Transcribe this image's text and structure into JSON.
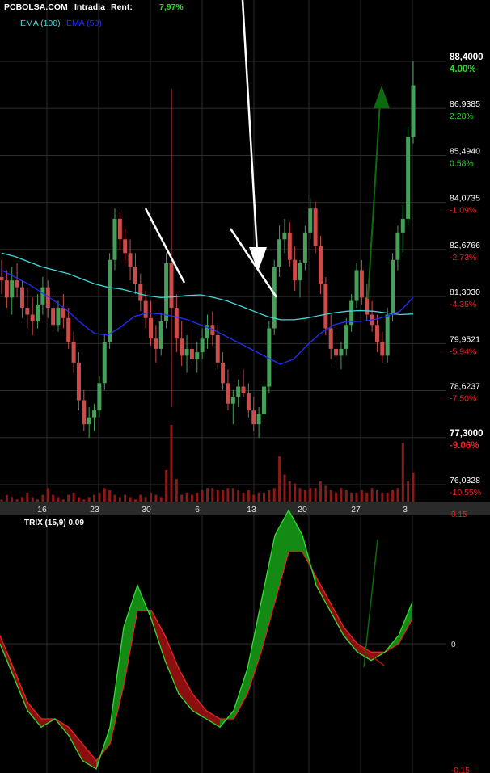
{
  "header": {
    "site": "PCBOLSA.COM",
    "mode": "Intradia",
    "rent_label": "Rent:",
    "rent_value": "7,97%"
  },
  "legend": {
    "ema100": "EMA (100)",
    "ema50": "EMA (50)"
  },
  "colors": {
    "background": "#000000",
    "grid": "#2e2e2e",
    "up": "#46a05a",
    "down": "#cc4c4c",
    "ema100": "#40d8d8",
    "ema50": "#2030ff",
    "positive_text": "#22dd22",
    "negative_text": "#ee2222",
    "trix_up_fill": "#138a13",
    "trix_down_fill": "#8a1010",
    "trix_line": "#33dd33",
    "signal_line": "#ee2222",
    "volume": "#8b1a1a"
  },
  "price_axis": [
    {
      "price": "88,4000",
      "pct": "4.00%",
      "bold": true
    },
    {
      "price": "86,9385",
      "pct": "2.28%",
      "bold": false
    },
    {
      "price": "85,4940",
      "pct": "0.58%",
      "bold": false
    },
    {
      "price": "84,0735",
      "pct": "-1.09%",
      "bold": false
    },
    {
      "price": "82,6766",
      "pct": "-2.73%",
      "bold": false
    },
    {
      "price": "81,3030",
      "pct": "-4.35%",
      "bold": false
    },
    {
      "price": "79,9521",
      "pct": "-5.94%",
      "bold": false
    },
    {
      "price": "78,6237",
      "pct": "-7.50%",
      "bold": false
    },
    {
      "price": "77,3000",
      "pct": "-9.06%",
      "bold": true
    },
    {
      "price": "76,0328",
      "pct": "-10.55%",
      "bold": false
    }
  ],
  "date_axis": [
    "16",
    "23",
    "30",
    "6",
    "13",
    "20",
    "27",
    "3"
  ],
  "trix": {
    "title": "TRIX (15,9) 0.09",
    "ticks": [
      "0.15",
      "0",
      "-0.15"
    ]
  },
  "chart_data": [
    {
      "type": "candlestick",
      "title": "PCBOLSA.COM Intradia",
      "ylim": [
        76.0328,
        88.4
      ],
      "x_ticks": [
        "16",
        "23",
        "30",
        "6",
        "13",
        "20",
        "27",
        "3"
      ],
      "candles_ohlc": [
        [
          82.1,
          82.6,
          81.6,
          82.0
        ],
        [
          82.0,
          82.3,
          81.2,
          81.5
        ],
        [
          81.5,
          82.4,
          81.0,
          82.0
        ],
        [
          82.0,
          82.5,
          81.5,
          81.8
        ],
        [
          81.8,
          82.0,
          80.9,
          81.2
        ],
        [
          81.2,
          81.8,
          80.6,
          81.0
        ],
        [
          81.0,
          81.5,
          80.4,
          80.8
        ],
        [
          80.8,
          81.6,
          80.6,
          81.3
        ],
        [
          81.3,
          82.1,
          81.0,
          81.8
        ],
        [
          81.8,
          82.0,
          80.9,
          81.2
        ],
        [
          81.2,
          81.6,
          80.5,
          80.7
        ],
        [
          80.7,
          81.4,
          80.5,
          81.2
        ],
        [
          81.2,
          81.6,
          80.6,
          80.9
        ],
        [
          80.9,
          81.2,
          80.0,
          80.2
        ],
        [
          80.2,
          80.5,
          79.3,
          79.6
        ],
        [
          79.6,
          79.9,
          78.2,
          78.5
        ],
        [
          78.5,
          78.8,
          77.6,
          77.8
        ],
        [
          77.8,
          78.3,
          77.4,
          78.0
        ],
        [
          78.0,
          78.4,
          77.6,
          78.2
        ],
        [
          78.2,
          79.2,
          78.0,
          79.0
        ],
        [
          79.0,
          80.4,
          78.8,
          80.2
        ],
        [
          80.2,
          82.8,
          80.0,
          82.6
        ],
        [
          82.6,
          84.1,
          82.3,
          83.8
        ],
        [
          83.8,
          84.0,
          82.9,
          83.2
        ],
        [
          83.2,
          83.5,
          82.5,
          82.8
        ],
        [
          82.8,
          83.2,
          82.0,
          82.4
        ],
        [
          82.4,
          82.8,
          81.6,
          81.9
        ],
        [
          81.9,
          82.2,
          81.1,
          81.4
        ],
        [
          81.4,
          81.7,
          80.6,
          80.9
        ],
        [
          80.9,
          81.4,
          80.1,
          80.3
        ],
        [
          80.3,
          80.7,
          79.6,
          80.0
        ],
        [
          80.0,
          81.0,
          79.8,
          80.8
        ],
        [
          80.8,
          82.8,
          80.6,
          82.5
        ],
        [
          82.5,
          87.6,
          78.3,
          81.2
        ],
        [
          81.2,
          81.6,
          79.9,
          80.3
        ],
        [
          80.3,
          80.8,
          79.5,
          79.8
        ],
        [
          79.8,
          80.4,
          79.3,
          80.0
        ],
        [
          80.0,
          80.6,
          79.5,
          79.7
        ],
        [
          79.7,
          80.2,
          79.3,
          79.9
        ],
        [
          79.9,
          80.6,
          79.7,
          80.3
        ],
        [
          80.3,
          81.0,
          80.0,
          80.7
        ],
        [
          80.7,
          81.1,
          80.1,
          80.4
        ],
        [
          80.4,
          80.7,
          79.4,
          79.6
        ],
        [
          79.6,
          79.9,
          78.8,
          79.0
        ],
        [
          79.0,
          79.4,
          78.2,
          78.4
        ],
        [
          78.4,
          78.8,
          77.8,
          78.6
        ],
        [
          78.6,
          79.1,
          78.3,
          78.9
        ],
        [
          78.9,
          79.4,
          78.6,
          78.7
        ],
        [
          78.7,
          79.0,
          78.0,
          78.2
        ],
        [
          78.2,
          78.6,
          77.6,
          77.8
        ],
        [
          77.8,
          78.3,
          77.4,
          78.1
        ],
        [
          78.1,
          79.0,
          78.0,
          78.9
        ],
        [
          78.9,
          80.8,
          78.7,
          80.6
        ],
        [
          80.6,
          82.6,
          80.4,
          82.4
        ],
        [
          82.4,
          83.6,
          82.1,
          83.2
        ],
        [
          83.2,
          83.8,
          82.8,
          83.4
        ],
        [
          83.4,
          83.7,
          82.4,
          82.6
        ],
        [
          82.6,
          83.0,
          81.7,
          82.0
        ],
        [
          82.0,
          82.6,
          81.5,
          82.5
        ],
        [
          82.5,
          83.6,
          82.3,
          83.4
        ],
        [
          83.4,
          84.4,
          83.2,
          84.1
        ],
        [
          84.1,
          84.3,
          82.8,
          83.0
        ],
        [
          83.0,
          83.3,
          81.6,
          81.9
        ],
        [
          81.9,
          82.1,
          80.4,
          80.6
        ],
        [
          80.6,
          81.0,
          79.7,
          80.0
        ],
        [
          80.0,
          80.4,
          79.5,
          79.8
        ],
        [
          79.8,
          80.2,
          79.4,
          80.0
        ],
        [
          80.0,
          80.9,
          79.8,
          80.7
        ],
        [
          80.7,
          81.6,
          80.5,
          81.4
        ],
        [
          81.4,
          82.5,
          81.2,
          82.3
        ],
        [
          82.3,
          82.6,
          81.3,
          81.5
        ],
        [
          81.5,
          81.9,
          80.8,
          81.0
        ],
        [
          81.0,
          81.4,
          80.5,
          80.7
        ],
        [
          80.7,
          81.0,
          79.9,
          80.2
        ],
        [
          80.2,
          80.5,
          79.6,
          79.8
        ],
        [
          79.8,
          81.2,
          79.6,
          81.0
        ],
        [
          81.0,
          82.8,
          80.8,
          82.6
        ],
        [
          82.6,
          83.6,
          82.3,
          83.4
        ],
        [
          83.4,
          84.2,
          82.8,
          83.8
        ],
        [
          83.8,
          86.5,
          83.6,
          86.2
        ],
        [
          86.2,
          88.4,
          86.0,
          87.7
        ]
      ]
    },
    {
      "type": "line",
      "title": "EMA overlays",
      "series": [
        {
          "name": "EMA (100)",
          "values": [
            82.8,
            82.7,
            82.55,
            82.4,
            82.3,
            82.2,
            82.05,
            81.9,
            81.8,
            81.75,
            81.65,
            81.55,
            81.5,
            81.52,
            81.56,
            81.58,
            81.5,
            81.4,
            81.25,
            81.1,
            80.95,
            80.85,
            80.85,
            80.9,
            80.98,
            81.05,
            81.1,
            81.12,
            81.1,
            81.05,
            81.0,
            81.02
          ]
        },
        {
          "name": "EMA (50)",
          "values": [
            82.3,
            82.1,
            81.9,
            81.65,
            81.4,
            81.1,
            80.75,
            80.45,
            80.4,
            80.65,
            80.95,
            81.05,
            81.02,
            80.95,
            80.85,
            80.7,
            80.55,
            80.35,
            80.15,
            79.95,
            79.75,
            79.55,
            79.7,
            80.1,
            80.45,
            80.7,
            80.8,
            80.8,
            80.85,
            80.95,
            81.1,
            81.5
          ]
        }
      ]
    },
    {
      "type": "bar",
      "title": "Volume",
      "values": [
        1,
        3,
        2,
        1,
        2,
        4,
        2,
        1,
        3,
        6,
        3,
        2,
        1,
        3,
        4,
        2,
        1,
        2,
        3,
        4,
        6,
        5,
        3,
        2,
        3,
        2,
        1,
        3,
        2,
        4,
        3,
        2,
        14,
        34,
        10,
        3,
        4,
        3,
        4,
        5,
        6,
        6,
        5,
        5,
        6,
        6,
        5,
        4,
        5,
        3,
        4,
        4,
        5,
        6,
        20,
        12,
        9,
        8,
        6,
        5,
        6,
        6,
        9,
        7,
        5,
        4,
        6,
        5,
        4,
        4,
        5,
        4,
        6,
        5,
        4,
        4,
        5,
        6,
        26,
        9,
        13
      ]
    },
    {
      "type": "line",
      "title": "TRIX (15,9)",
      "ylim": [
        -0.15,
        0.15
      ],
      "series": [
        {
          "name": "TRIX",
          "values": [
            0.0,
            -0.04,
            -0.08,
            -0.1,
            -0.09,
            -0.11,
            -0.14,
            -0.15,
            -0.1,
            0.02,
            0.07,
            0.03,
            -0.02,
            -0.06,
            -0.08,
            -0.09,
            -0.1,
            -0.08,
            -0.03,
            0.05,
            0.13,
            0.16,
            0.13,
            0.07,
            0.04,
            0.01,
            -0.01,
            -0.02,
            -0.01,
            0.01,
            0.05
          ]
        },
        {
          "name": "Signal",
          "values": [
            0.01,
            -0.03,
            -0.07,
            -0.09,
            -0.09,
            -0.1,
            -0.12,
            -0.14,
            -0.12,
            -0.05,
            0.04,
            0.04,
            0.01,
            -0.03,
            -0.06,
            -0.08,
            -0.09,
            -0.09,
            -0.06,
            -0.01,
            0.05,
            0.11,
            0.11,
            0.08,
            0.05,
            0.02,
            0.0,
            -0.01,
            -0.01,
            0.0,
            0.03
          ]
        }
      ]
    }
  ]
}
